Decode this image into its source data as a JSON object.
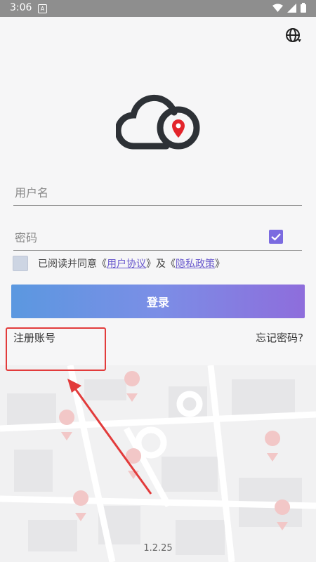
{
  "status_bar": {
    "time": "3:06",
    "a_icon": "A",
    "icons": [
      "wifi-icon",
      "signal-icon",
      "battery-icon"
    ]
  },
  "header": {
    "language_icon": "globe-icon"
  },
  "logo": {
    "icon": "cloud-location-pin-icon",
    "pin_color": "#e3242b",
    "cloud_color": "#2d3136"
  },
  "form": {
    "username": {
      "placeholder": "用户名",
      "value": ""
    },
    "password": {
      "placeholder": "密码",
      "value": ""
    },
    "agreement": {
      "checked": false,
      "prefix": "已阅读并同意",
      "open1": "《",
      "user_agreement": "用户协议",
      "close1": "》",
      "conjunction": "及",
      "open2": "《",
      "privacy_policy": "隐私政策",
      "close2": "》"
    },
    "login_label": "登录"
  },
  "links": {
    "register": "注册账号",
    "forgot_password": "忘记密码?"
  },
  "version": "1.2.25",
  "colors": {
    "accent": "#6a5acd",
    "gradient_start": "#5b98e0",
    "gradient_end": "#8e6ddc",
    "highlight": "#e23b3b"
  }
}
